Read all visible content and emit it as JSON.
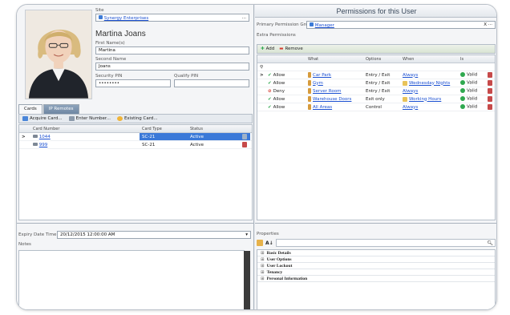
{
  "person": {
    "site_label": "Site",
    "site_value": "Synergy Enterprises",
    "site_button": "...",
    "full_name": "Martina Joans",
    "first_name_label": "First Name(s)",
    "first_name": "Martina",
    "second_name_label": "Second Name",
    "second_name": "Joans",
    "security_pin_label": "Security PIN",
    "security_pin": "••••••••",
    "qualify_pin_label": "Qualify PIN",
    "qualify_pin": ""
  },
  "cards": {
    "tabs": [
      "Cards",
      "IP Remotes"
    ],
    "toolbar": [
      "Acquire Card...",
      "Enter Number...",
      "Existing Card..."
    ],
    "columns": [
      "Card Number",
      "Card Type",
      "Status"
    ],
    "rows": [
      {
        "marker": ">",
        "number": "1044",
        "type": "SC-21",
        "status": "Active"
      },
      {
        "marker": "",
        "number": "999",
        "type": "SC-21",
        "status": "Active"
      }
    ]
  },
  "details": {
    "expiry_label": "Expiry Date Time",
    "expiry_value": "20/12/2015 12:00:00 AM",
    "notes_label": "Notes"
  },
  "permissions": {
    "title": "Permissions for this User",
    "primary_group_label": "Primary Permission Group",
    "primary_group_value": "Manager",
    "primary_group_close": "X",
    "primary_group_more": "···",
    "extra_label": "Extra Permissions",
    "add_label": "Add",
    "remove_label": "Remove",
    "columns": [
      "What",
      "Options",
      "When",
      "Is"
    ],
    "rows": [
      {
        "marker": ">",
        "action": "Allow",
        "what": "Car Park",
        "options": "Entry / Exit",
        "when": "Always",
        "is": "Valid",
        "action_color": "#2fa84f",
        "deny": false,
        "when_icon": false
      },
      {
        "marker": "",
        "action": "Allow",
        "what": "Gym",
        "options": "Entry / Exit",
        "when": "Wednesday Nights",
        "is": "Valid",
        "action_color": "#2fa84f",
        "deny": false,
        "when_icon": true
      },
      {
        "marker": "",
        "action": "Deny",
        "what": "Server Room",
        "options": "Entry / Exit",
        "when": "Always",
        "is": "Valid",
        "action_color": "#d43a2f",
        "deny": true,
        "when_icon": false
      },
      {
        "marker": "",
        "action": "Allow",
        "what": "Warehouse Doors",
        "options": "Exit only",
        "when": "Working Hours",
        "is": "Valid",
        "action_color": "#2fa84f",
        "deny": false,
        "when_icon": true
      },
      {
        "marker": "",
        "action": "Allow",
        "what": "All Areas",
        "options": "Control",
        "when": "Always",
        "is": "Valid",
        "action_color": "#2fa84f",
        "deny": false,
        "when_icon": false
      }
    ]
  },
  "properties": {
    "label": "Properties",
    "categories": [
      "Basic Details",
      "User Options",
      "User Lockout",
      "Tenancy",
      "Personal Information"
    ]
  }
}
